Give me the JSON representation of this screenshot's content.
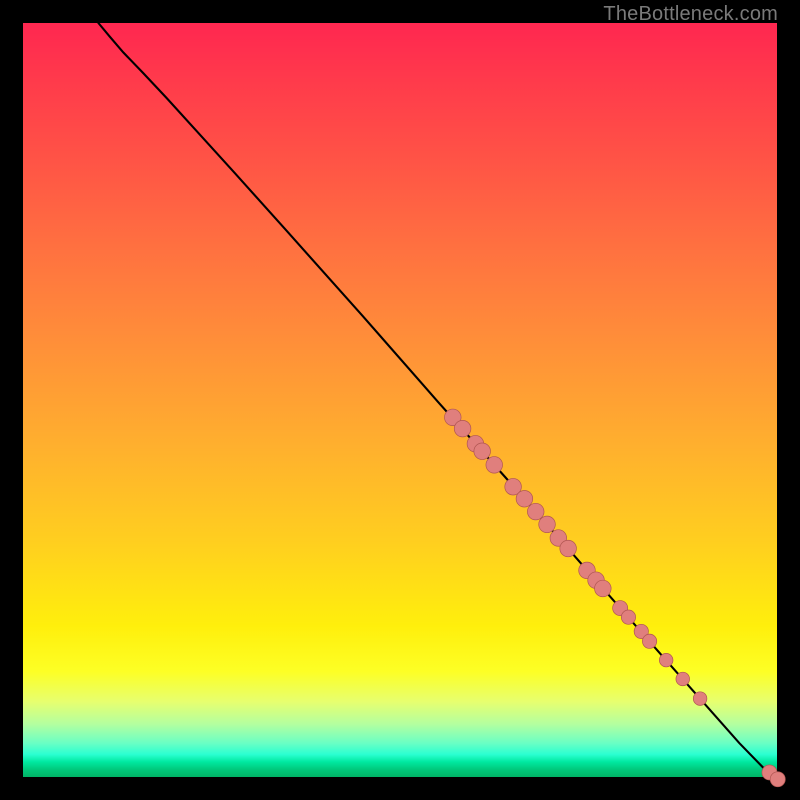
{
  "watermark": "TheBottleneck.com",
  "colors": {
    "dot_fill": "#e07f7d",
    "dot_stroke": "#b05652",
    "curve": "#000000"
  },
  "chart_data": {
    "type": "line",
    "title": "",
    "xlabel": "",
    "ylabel": "",
    "xlim": [
      0,
      100
    ],
    "ylim": [
      0,
      100
    ],
    "curve": [
      {
        "x": 10.0,
        "y": 100.0
      },
      {
        "x": 11.5,
        "y": 98.2
      },
      {
        "x": 13.3,
        "y": 96.1
      },
      {
        "x": 15.9,
        "y": 93.4
      },
      {
        "x": 19.0,
        "y": 90.1
      },
      {
        "x": 23.0,
        "y": 85.7
      },
      {
        "x": 28.0,
        "y": 80.2
      },
      {
        "x": 35.0,
        "y": 72.4
      },
      {
        "x": 45.0,
        "y": 61.2
      },
      {
        "x": 55.0,
        "y": 49.8
      },
      {
        "x": 65.0,
        "y": 38.6
      },
      {
        "x": 75.0,
        "y": 27.2
      },
      {
        "x": 85.0,
        "y": 15.8
      },
      {
        "x": 95.0,
        "y": 4.5
      },
      {
        "x": 98.5,
        "y": 0.9
      },
      {
        "x": 99.5,
        "y": 0.2
      }
    ],
    "points": [
      {
        "x": 57.0,
        "y": 47.7,
        "r": 1.1
      },
      {
        "x": 58.3,
        "y": 46.2,
        "r": 1.1
      },
      {
        "x": 60.0,
        "y": 44.2,
        "r": 1.1
      },
      {
        "x": 60.9,
        "y": 43.2,
        "r": 1.1
      },
      {
        "x": 62.5,
        "y": 41.4,
        "r": 1.1
      },
      {
        "x": 65.0,
        "y": 38.5,
        "r": 1.1
      },
      {
        "x": 66.5,
        "y": 36.9,
        "r": 1.1
      },
      {
        "x": 68.0,
        "y": 35.2,
        "r": 1.1
      },
      {
        "x": 69.5,
        "y": 33.5,
        "r": 1.1
      },
      {
        "x": 71.0,
        "y": 31.7,
        "r": 1.1
      },
      {
        "x": 72.3,
        "y": 30.3,
        "r": 1.1
      },
      {
        "x": 74.8,
        "y": 27.4,
        "r": 1.1
      },
      {
        "x": 76.0,
        "y": 26.1,
        "r": 1.1
      },
      {
        "x": 76.9,
        "y": 25.0,
        "r": 1.1
      },
      {
        "x": 79.2,
        "y": 22.4,
        "r": 1.0
      },
      {
        "x": 80.3,
        "y": 21.2,
        "r": 0.95
      },
      {
        "x": 82.0,
        "y": 19.3,
        "r": 0.95
      },
      {
        "x": 83.1,
        "y": 18.0,
        "r": 0.95
      },
      {
        "x": 85.3,
        "y": 15.5,
        "r": 0.9
      },
      {
        "x": 87.5,
        "y": 13.0,
        "r": 0.9
      },
      {
        "x": 89.8,
        "y": 10.4,
        "r": 0.9
      },
      {
        "x": 99.0,
        "y": 0.6,
        "r": 1.0
      },
      {
        "x": 100.1,
        "y": -0.3,
        "r": 1.0
      }
    ]
  }
}
